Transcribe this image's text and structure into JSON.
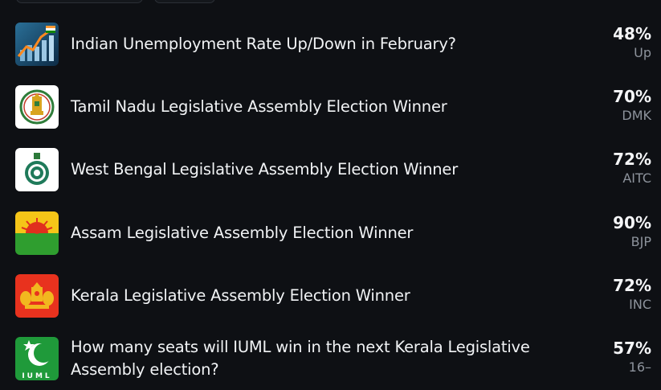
{
  "markets": [
    {
      "title": "Indian Unemployment Rate Up/Down in February?",
      "percent": "48%",
      "outcome": "Up",
      "icon": "unemployment-chart-icon"
    },
    {
      "title": "Tamil Nadu Legislative Assembly Election Winner",
      "percent": "70%",
      "outcome": "DMK",
      "icon": "tamil-nadu-emblem-icon"
    },
    {
      "title": "West Bengal Legislative Assembly Election Winner",
      "percent": "72%",
      "outcome": "AITC",
      "icon": "west-bengal-emblem-icon"
    },
    {
      "title": "Assam Legislative Assembly Election Winner",
      "percent": "90%",
      "outcome": "BJP",
      "icon": "assam-flag-icon"
    },
    {
      "title": "Kerala Legislative Assembly Election Winner",
      "percent": "72%",
      "outcome": "INC",
      "icon": "kerala-emblem-icon"
    },
    {
      "title": "How many seats will IUML win in the next Kerala Legislative Assembly election?",
      "percent": "57%",
      "outcome": "16–",
      "icon": "iuml-logo-icon",
      "icon_text": "IUML"
    }
  ]
}
